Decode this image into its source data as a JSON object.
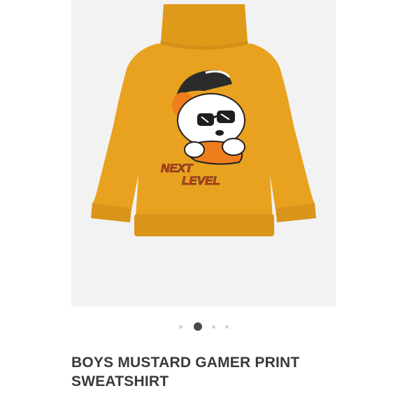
{
  "product": {
    "title_line1": "BOYS MUSTARD GAMER PRINT",
    "title_line2": "SWEATSHIRT",
    "print_text_line1": "NEXT",
    "print_text_line2": "LEVEL"
  },
  "gallery": {
    "image_count": 4,
    "active_index": 1
  },
  "icons": {
    "wishlist": "heart-outline-icon"
  },
  "colors": {
    "garment": "#e8a21f",
    "print_accent": "#e2401d",
    "dot_active": "#4a4a4a",
    "dot_inactive": "#d3d3d3",
    "title": "#3a3a3a"
  }
}
